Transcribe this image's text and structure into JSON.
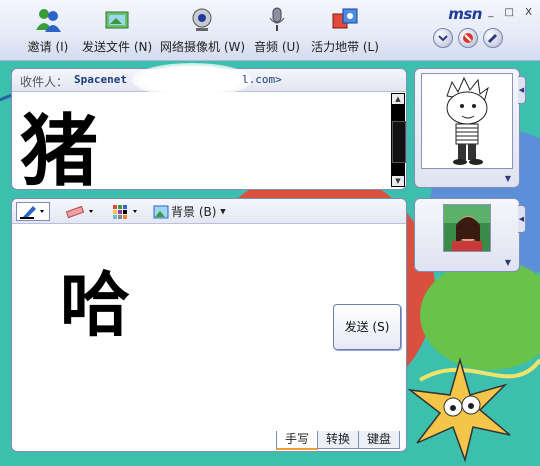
{
  "toolbar": {
    "items": [
      {
        "label": "邀请 (I)",
        "icon": "invite-people-icon"
      },
      {
        "label": "发送文件 (N)",
        "icon": "send-file-icon"
      },
      {
        "label": "网络摄像机 (W)",
        "icon": "webcam-icon"
      },
      {
        "label": "音频 (U)",
        "icon": "microphone-icon"
      },
      {
        "label": "活力地带 (L)",
        "icon": "activities-icon"
      }
    ],
    "logo": "msn",
    "window_controls": "_ □ X"
  },
  "recipient": {
    "label": "收件人：",
    "value": "Spacenet",
    "suffix": "l.com>"
  },
  "history": {
    "handwriting": "猪"
  },
  "format_bar": {
    "pen_icon": "pen-icon",
    "eraser_icon": "eraser-icon",
    "color_icon": "color-palette-icon",
    "background_label": "背景 (B)",
    "background_icon": "background-image-icon"
  },
  "compose": {
    "handwriting": "哈"
  },
  "send_button": {
    "label": "发送 (S)"
  },
  "mode_tabs": [
    {
      "label": "手写",
      "active": true
    },
    {
      "label": "转换",
      "active": false
    },
    {
      "label": "键盘",
      "active": false
    }
  ],
  "colors": {
    "background": "#3dbfae",
    "toolbar": "#e6ebf7",
    "accent": "#1f3c9c",
    "ink": "#000000"
  }
}
